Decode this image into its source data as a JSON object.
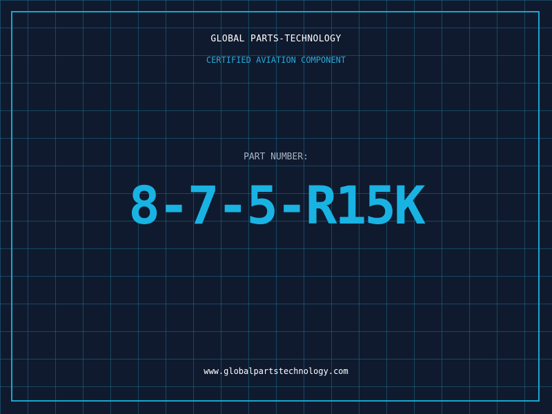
{
  "header": {
    "company": "GLOBAL PARTS-TECHNOLOGY",
    "tagline": "CERTIFIED AVIATION COMPONENT"
  },
  "part": {
    "label": "PART NUMBER:",
    "number": "8-7-5-R15K"
  },
  "footer": {
    "website": "www.globalpartstechnology.com"
  },
  "colors": {
    "background": "#0f1a2e",
    "grid": "#1f6e8c",
    "accent": "#19b3e3",
    "border": "#1aa6d2"
  }
}
